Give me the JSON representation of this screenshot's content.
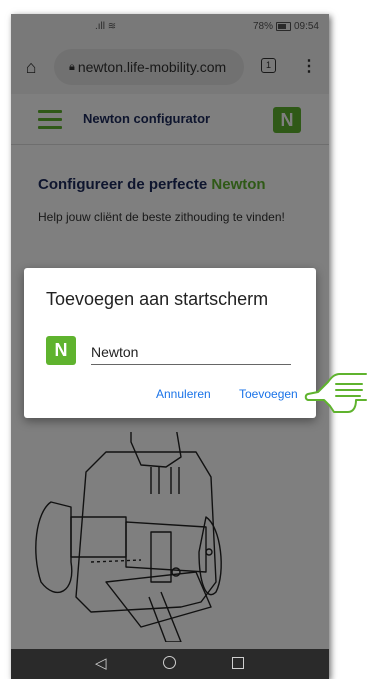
{
  "status_bar": {
    "battery": "78%",
    "time": "09:54"
  },
  "browser": {
    "url": "newton.life-mobility.com",
    "tab_count": "1"
  },
  "app_header": {
    "title": "Newton configurator",
    "logo_letter": "N"
  },
  "hero": {
    "title_main": "Configureer de perfecte",
    "title_accent": "Newton",
    "subtitle": "Help jouw cliënt de beste zithouding te vinden!"
  },
  "dialog": {
    "title": "Toevoegen aan startscherm",
    "icon_letter": "N",
    "name_value": "Newton",
    "cancel_label": "Annuleren",
    "add_label": "Toevoegen"
  },
  "colors": {
    "brand_green": "#5fb32e",
    "navy": "#1d2a5c",
    "link_blue": "#1a73e8"
  }
}
